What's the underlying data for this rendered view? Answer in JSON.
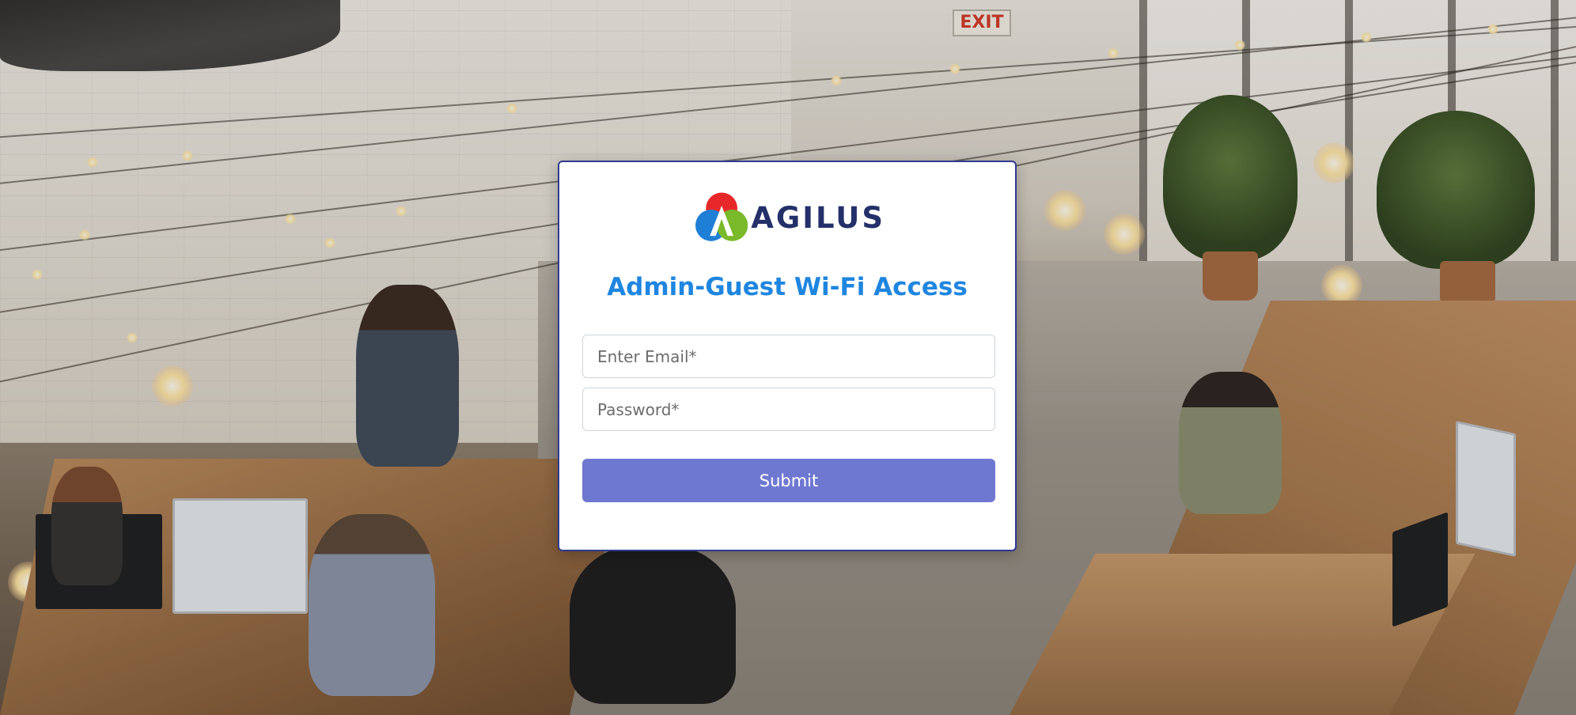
{
  "background": {
    "exit_sign": "EXIT"
  },
  "login": {
    "logo_text": "AGILUS",
    "title": "Admin-Guest Wi-Fi Access",
    "email_placeholder": "Enter Email*",
    "email_value": "",
    "password_placeholder": "Password*",
    "password_value": "",
    "submit_label": "Submit"
  },
  "colors": {
    "title": "#1f86e0",
    "submit_button": "#6f78d1",
    "card_border": "#2f3a8f",
    "logo_text": "#233069",
    "logo_red": "#e8272a",
    "logo_blue": "#1f7fd6",
    "logo_green": "#7ab929"
  }
}
